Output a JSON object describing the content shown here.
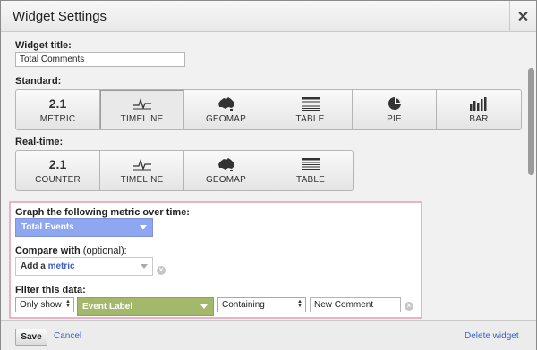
{
  "dialog": {
    "title": "Widget Settings",
    "close_glyph": "✕"
  },
  "widget_title": {
    "label": "Widget title:",
    "value": "Total Comments"
  },
  "standard": {
    "label": "Standard:",
    "buttons": [
      {
        "label": "METRIC",
        "top_text": "2.1",
        "icon": "metric-number-icon",
        "selected": false
      },
      {
        "label": "TIMELINE",
        "icon": "timeline-icon",
        "selected": true
      },
      {
        "label": "GEOMAP",
        "icon": "australia-map-icon",
        "selected": false
      },
      {
        "label": "TABLE",
        "icon": "table-icon",
        "selected": false
      },
      {
        "label": "PIE",
        "icon": "pie-chart-icon",
        "selected": false
      },
      {
        "label": "BAR",
        "icon": "bar-chart-icon",
        "selected": false
      }
    ]
  },
  "realtime": {
    "label": "Real-time:",
    "buttons": [
      {
        "label": "COUNTER",
        "top_text": "2.1",
        "icon": "counter-number-icon"
      },
      {
        "label": "TIMELINE",
        "icon": "timeline-icon"
      },
      {
        "label": "GEOMAP",
        "icon": "australia-map-icon"
      },
      {
        "label": "TABLE",
        "icon": "table-icon"
      }
    ]
  },
  "graph": {
    "label": "Graph the following metric over time:",
    "metric_value": "Total Events"
  },
  "compare": {
    "label_bold": "Compare with",
    "label_normal": " (optional):",
    "add_prefix": "Add a ",
    "add_metric_word": "metric"
  },
  "filter": {
    "label": "Filter this data:",
    "mode": "Only show",
    "dimension": "Event Label",
    "match_type": "Containing",
    "value": "New Comment"
  },
  "footer": {
    "save": "Save",
    "cancel": "Cancel",
    "delete": "Delete widget"
  },
  "colors": {
    "metric_select": "#8fa6f0",
    "dimension_select": "#a4b86c",
    "highlight_border": "#e6b3c8",
    "link": "#3b5fc6"
  }
}
